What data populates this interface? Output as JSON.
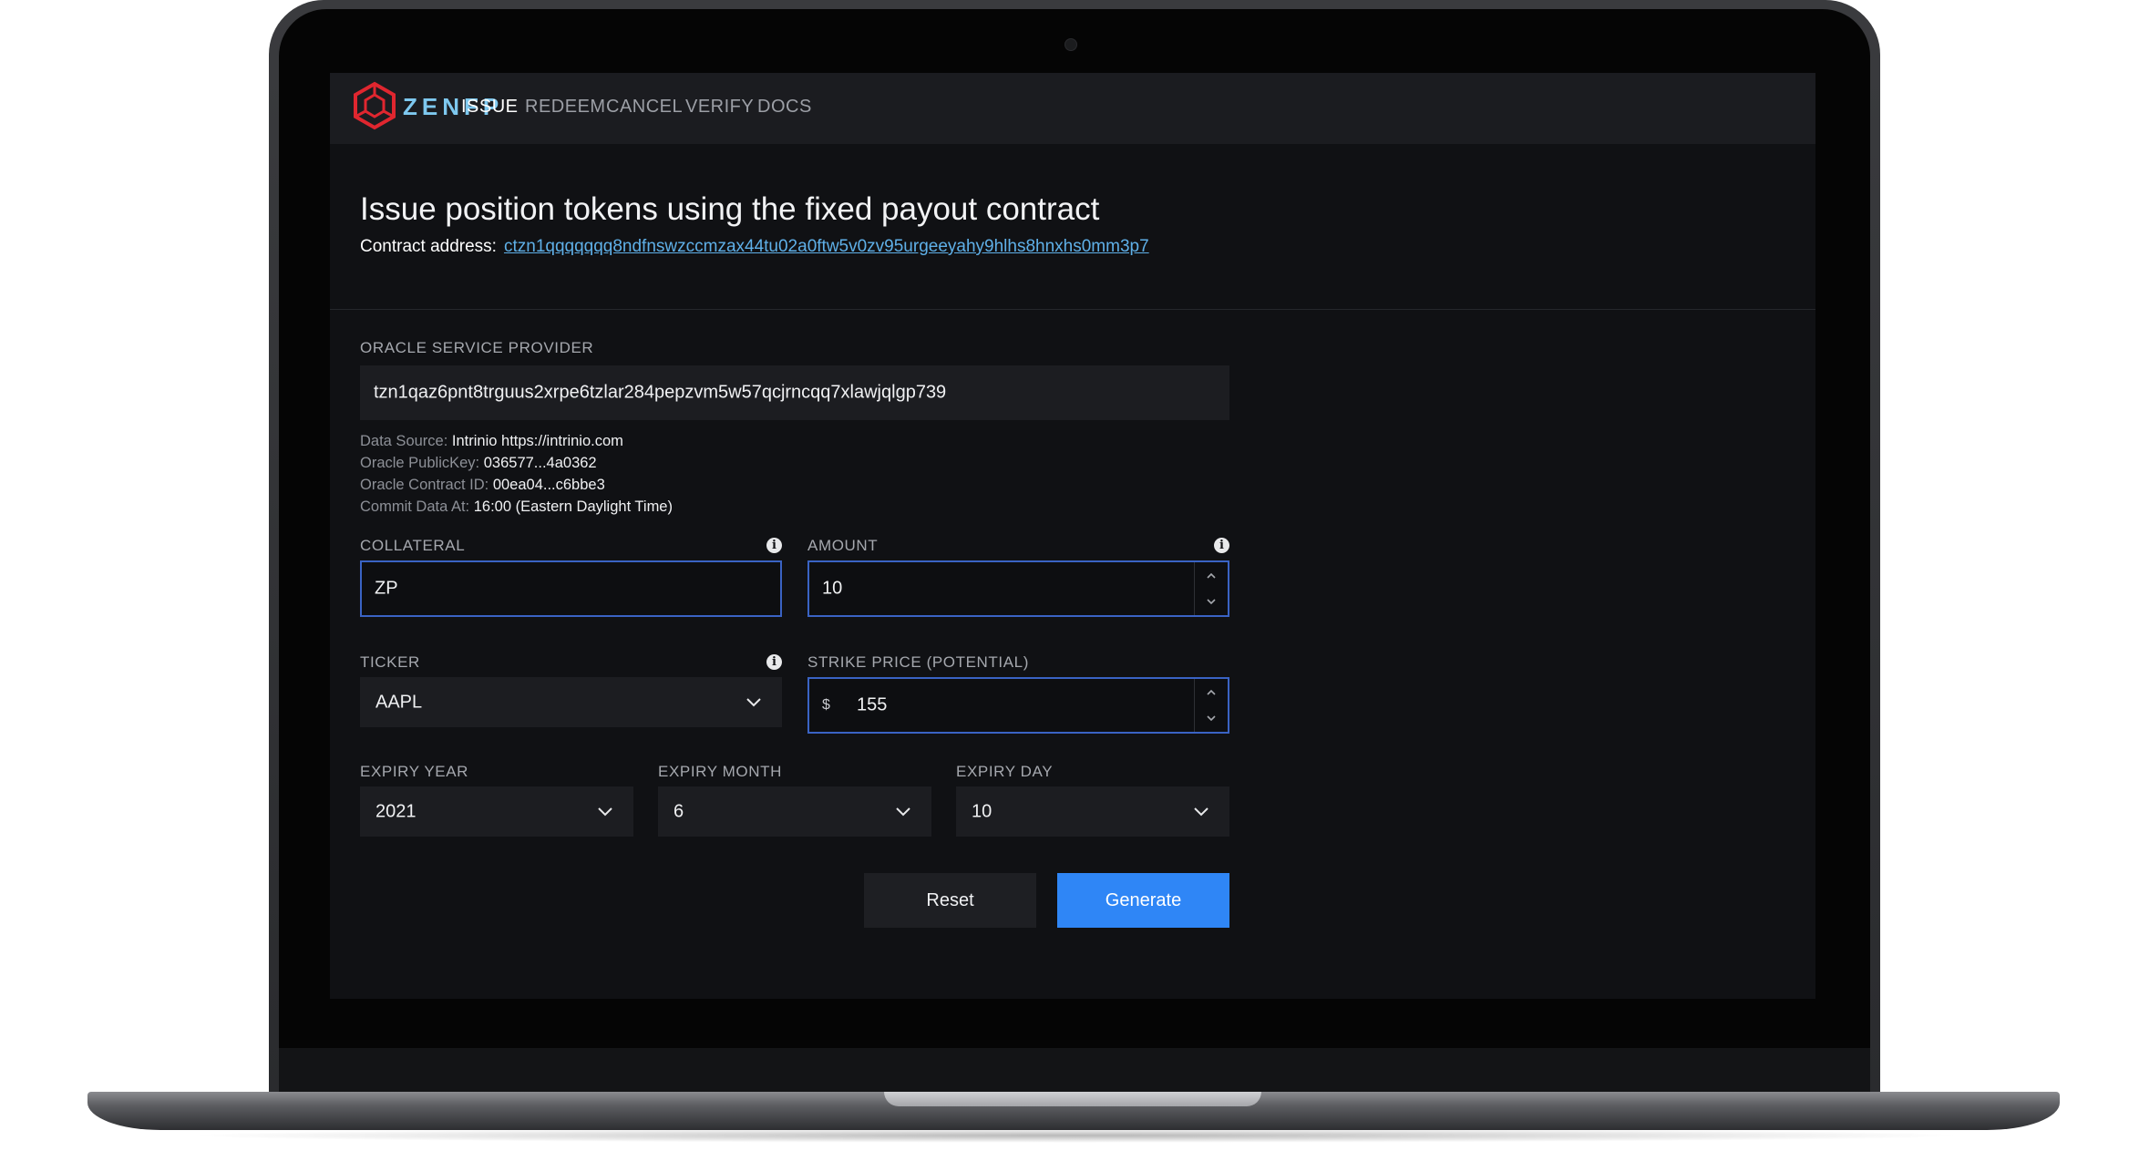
{
  "brand": {
    "name": "ZENFP",
    "accent_color": "#7ec8ef",
    "mark_color": "#e0262f"
  },
  "nav": {
    "items": [
      {
        "label": "ISSUE",
        "active": true
      },
      {
        "label": "REDEEM",
        "active": false
      },
      {
        "label": "CANCEL",
        "active": false
      },
      {
        "label": "VERIFY",
        "active": false
      },
      {
        "label": "DOCS",
        "active": false
      }
    ]
  },
  "page": {
    "title": "Issue position tokens using the fixed payout contract",
    "contract_label": "Contract address:",
    "contract_address": "ctzn1qqqqqqq8ndfnswzccmzax44tu02a0ftw5v0zv95urgeeyahy9hlhs8hnxhs0mm3p7"
  },
  "oracle": {
    "label": "ORACLE SERVICE PROVIDER",
    "value": "tzn1qaz6pnt8trguus2xrpe6tzlar284pepzvm5w57qcjrncqq7xlawjqlgp739",
    "data_source_label": "Data Source:",
    "data_source_value": "Intrinio https://intrinio.com",
    "public_key_label": "Oracle PublicKey:",
    "public_key_value": "036577...4a0362",
    "contract_id_label": "Oracle Contract ID:",
    "contract_id_value": "00ea04...c6bbe3",
    "commit_label": "Commit Data At:",
    "commit_value": "16:00 (Eastern Daylight Time)"
  },
  "form": {
    "collateral": {
      "label": "COLLATERAL",
      "value": "ZP"
    },
    "amount": {
      "label": "AMOUNT",
      "value": "10"
    },
    "ticker": {
      "label": "TICKER",
      "value": "AAPL"
    },
    "strike": {
      "label": "STRIKE PRICE (POTENTIAL)",
      "currency": "$",
      "value": "155"
    },
    "expiry_year": {
      "label": "EXPIRY YEAR",
      "value": "2021"
    },
    "expiry_month": {
      "label": "EXPIRY MONTH",
      "value": "6"
    },
    "expiry_day": {
      "label": "EXPIRY DAY",
      "value": "10"
    },
    "info_glyph": "i"
  },
  "actions": {
    "reset_label": "Reset",
    "generate_label": "Generate",
    "primary_color": "#2f86f6"
  }
}
